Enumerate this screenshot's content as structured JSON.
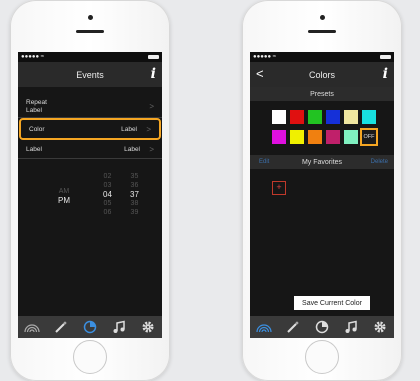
{
  "status": {
    "signal": "●●●●● ≈"
  },
  "events": {
    "title": "Events",
    "info": "i",
    "rows": [
      {
        "label": "Repeat\nLabel",
        "value": ""
      },
      {
        "label": "Color",
        "value": "Label"
      },
      {
        "label": "Label",
        "value": "Label"
      }
    ],
    "picker": {
      "ampm": [
        "AM",
        "PM"
      ],
      "hours": [
        "02",
        "03",
        "04",
        "05",
        "06"
      ],
      "minutes": [
        "35",
        "36",
        "37",
        "38",
        "39"
      ],
      "selected_hour": "04",
      "selected_minute": "37"
    }
  },
  "colors": {
    "title": "Colors",
    "info": "i",
    "back": "<",
    "presets_label": "Presets",
    "swatches": [
      "#ffffff",
      "#e01010",
      "#22c322",
      "#1530d8",
      "#efe6a0",
      "#18e0e0",
      "#e010e0",
      "#f0f000",
      "#f08010",
      "#c0206a",
      "#80f0c0"
    ],
    "off_label": "OFF",
    "favorites_title": "My Favorites",
    "edit_label": "Edit",
    "delete_label": "Delete",
    "add_label": "+",
    "save_label": "Save Current Color"
  },
  "accent": "#f5a623"
}
